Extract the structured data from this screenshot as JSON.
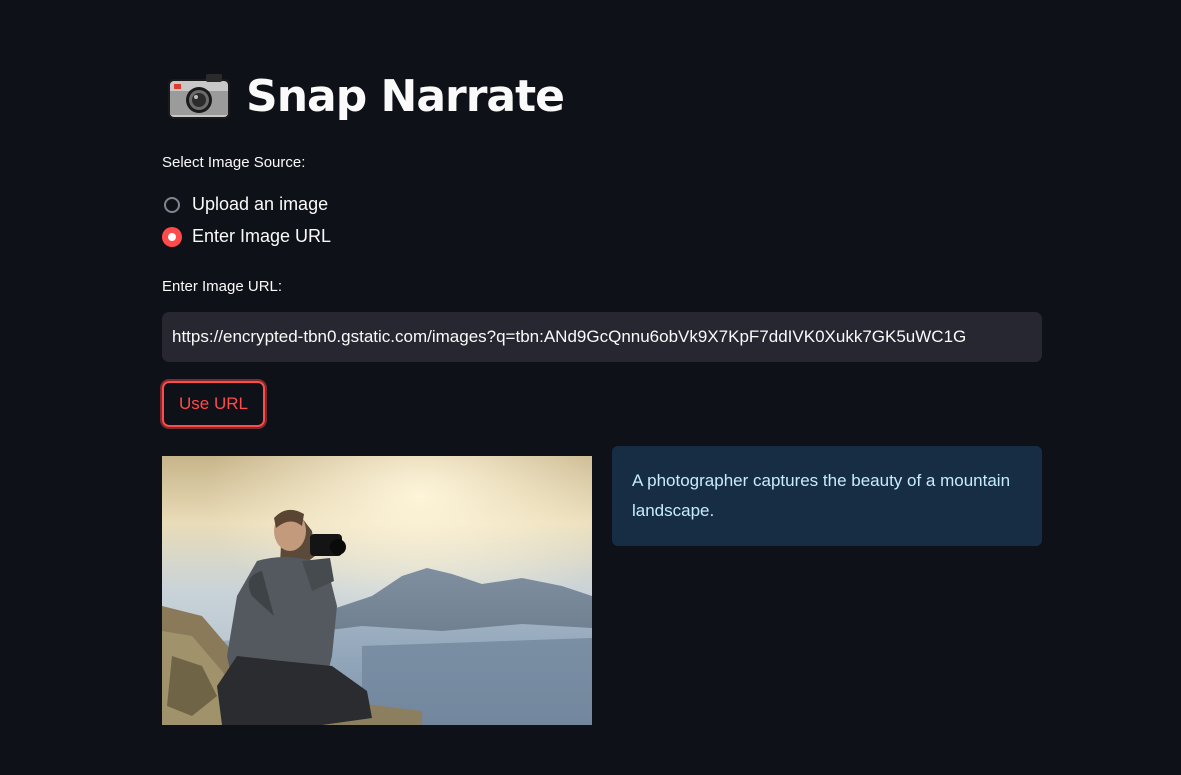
{
  "header": {
    "icon": "camera-icon",
    "title": "Snap Narrate"
  },
  "source_selector": {
    "label": "Select Image Source:",
    "options": [
      {
        "label": "Upload an image",
        "selected": false
      },
      {
        "label": "Enter Image URL",
        "selected": true
      }
    ]
  },
  "url_input": {
    "label": "Enter Image URL:",
    "value": "https://encrypted-tbn0.gstatic.com/images?q=tbn:ANd9GcQnnu6obVk9X7KpF7ddIVK0Xukk7GK5uWC1G"
  },
  "use_url_button": {
    "label": "Use URL"
  },
  "result": {
    "image": "photographer-mountain-photo",
    "caption": "A photographer captures the beauty of a mountain landscape."
  },
  "colors": {
    "background": "#0e1117",
    "accent": "#ff4b4b",
    "input_bg": "#262730",
    "caption_bg": "#172d43",
    "caption_text": "#c7ebff"
  }
}
